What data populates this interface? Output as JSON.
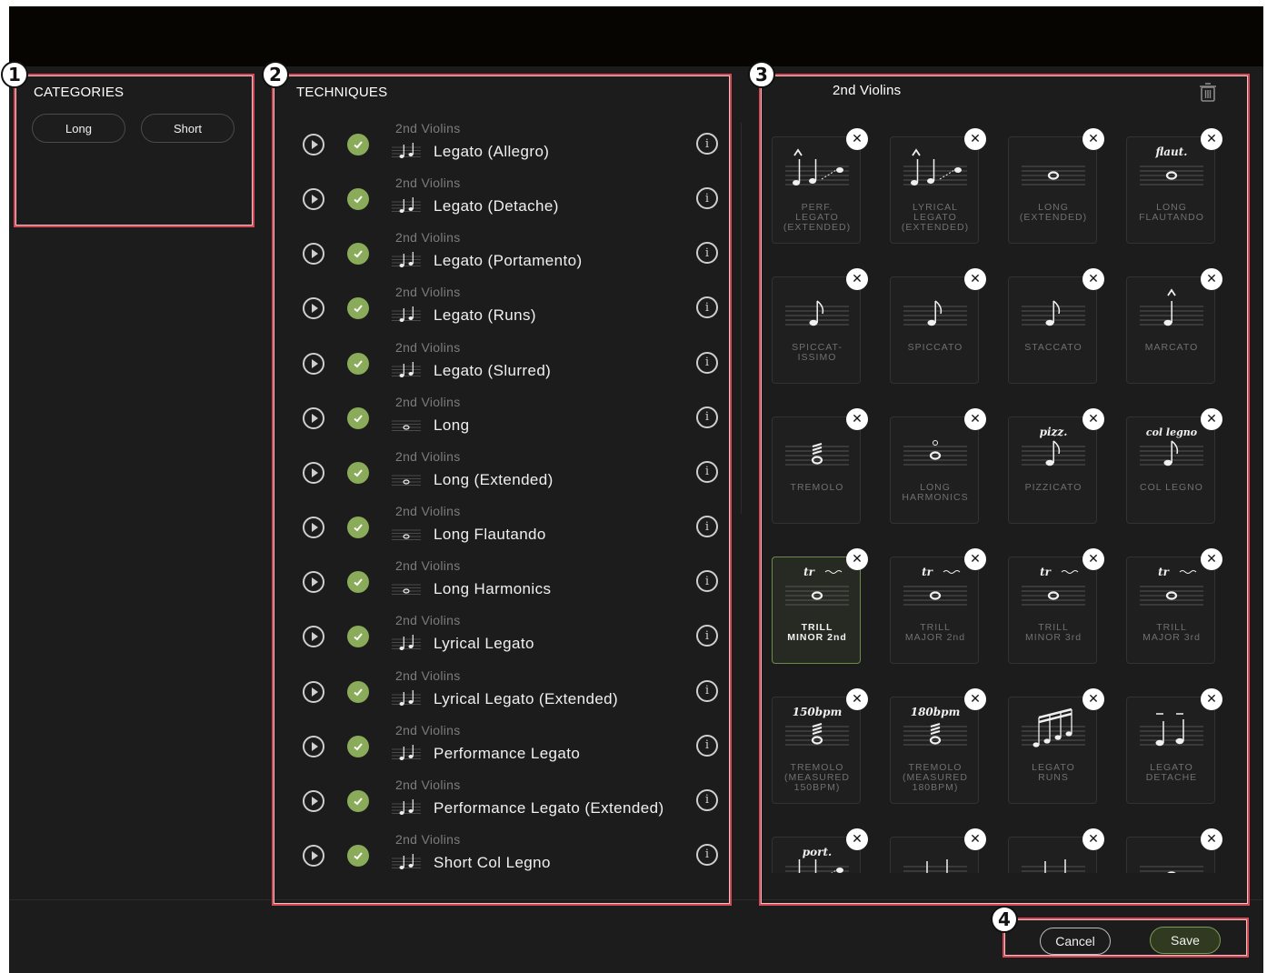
{
  "callouts": [
    "1",
    "2",
    "3",
    "4"
  ],
  "categories": {
    "title": "CATEGORIES",
    "items": [
      "Long",
      "Short"
    ]
  },
  "techniques": {
    "title": "TECHNIQUES",
    "items": [
      {
        "instrument": "2nd Violins",
        "name": "Legato (Allegro)",
        "icon": "two-eighth-notes-icon"
      },
      {
        "instrument": "2nd Violins",
        "name": "Legato (Detache)",
        "icon": "detache-notes-icon"
      },
      {
        "instrument": "2nd Violins",
        "name": "Legato (Portamento)",
        "icon": "portamento-icon"
      },
      {
        "instrument": "2nd Violins",
        "name": "Legato (Runs)",
        "icon": "runs-icon"
      },
      {
        "instrument": "2nd Violins",
        "name": "Legato (Slurred)",
        "icon": "slurred-notes-icon"
      },
      {
        "instrument": "2nd Violins",
        "name": "Long",
        "icon": "whole-note-icon"
      },
      {
        "instrument": "2nd Violins",
        "name": "Long (Extended)",
        "icon": "whole-note-icon"
      },
      {
        "instrument": "2nd Violins",
        "name": "Long Flautando",
        "icon": "flautando-icon"
      },
      {
        "instrument": "2nd Violins",
        "name": "Long Harmonics",
        "icon": "harmonics-icon"
      },
      {
        "instrument": "2nd Violins",
        "name": "Lyrical Legato",
        "icon": "two-notes-icon"
      },
      {
        "instrument": "2nd Violins",
        "name": "Lyrical Legato (Extended)",
        "icon": "legato-extended-icon"
      },
      {
        "instrument": "2nd Violins",
        "name": "Performance Legato",
        "icon": "two-notes-icon"
      },
      {
        "instrument": "2nd Violins",
        "name": "Performance Legato (Extended)",
        "icon": "legato-extended-icon"
      },
      {
        "instrument": "2nd Violins",
        "name": "Short Col Legno",
        "icon": "col-legno-icon"
      }
    ]
  },
  "selection": {
    "title": "2nd Violins",
    "trash_icon": "trash-icon",
    "cards": [
      {
        "label": "PERF.\nLEGATO\n(EXTENDED)",
        "marking": "",
        "glyph": "legato-ext"
      },
      {
        "label": "LYRICAL\nLEGATO\n(EXTENDED)",
        "marking": "",
        "glyph": "legato-ext"
      },
      {
        "label": "LONG\n(EXTENDED)",
        "marking": "",
        "glyph": "whole"
      },
      {
        "label": "LONG\nFLAUTANDO",
        "marking": "flaut.",
        "glyph": "whole"
      },
      {
        "label": "SPICCAT-\nISSIMO",
        "marking": "",
        "glyph": "eighth"
      },
      {
        "label": "SPICCATO",
        "marking": "",
        "glyph": "eighth"
      },
      {
        "label": "STACCATO",
        "marking": "",
        "glyph": "eighth"
      },
      {
        "label": "MARCATO",
        "marking": "",
        "glyph": "marcato"
      },
      {
        "label": "TREMOLO",
        "marking": "",
        "glyph": "tremolo"
      },
      {
        "label": "LONG\nHARMONICS",
        "marking": "",
        "glyph": "harmonic"
      },
      {
        "label": "PIZZICATO",
        "marking": "pizz.",
        "glyph": "eighth"
      },
      {
        "label": "COL LEGNO",
        "marking": "col legno",
        "glyph": "eighth"
      },
      {
        "label": "TRILL\nMINOR 2nd",
        "marking": "tr",
        "glyph": "trill",
        "selected": true
      },
      {
        "label": "TRILL\nMAJOR 2nd",
        "marking": "tr",
        "glyph": "trill"
      },
      {
        "label": "TRILL\nMINOR 3rd",
        "marking": "tr",
        "glyph": "trill"
      },
      {
        "label": "TRILL\nMAJOR 3rd",
        "marking": "tr",
        "glyph": "trill"
      },
      {
        "label": "TREMOLO\n(MEASURED\n150BPM)",
        "marking": "150bpm",
        "glyph": "tremolo"
      },
      {
        "label": "TREMOLO\n(MEASURED\n180BPM)",
        "marking": "180bpm",
        "glyph": "tremolo"
      },
      {
        "label": "LEGATO\nRUNS",
        "marking": "",
        "glyph": "runs"
      },
      {
        "label": "LEGATO\nDETACHE",
        "marking": "",
        "glyph": "detache"
      },
      {
        "label": "",
        "marking": "port.",
        "glyph": "port"
      },
      {
        "label": "",
        "marking": "",
        "glyph": "two"
      },
      {
        "label": "",
        "marking": "",
        "glyph": "two"
      },
      {
        "label": "",
        "marking": "",
        "glyph": "whole"
      }
    ]
  },
  "footer": {
    "cancel_label": "Cancel",
    "save_label": "Save"
  }
}
